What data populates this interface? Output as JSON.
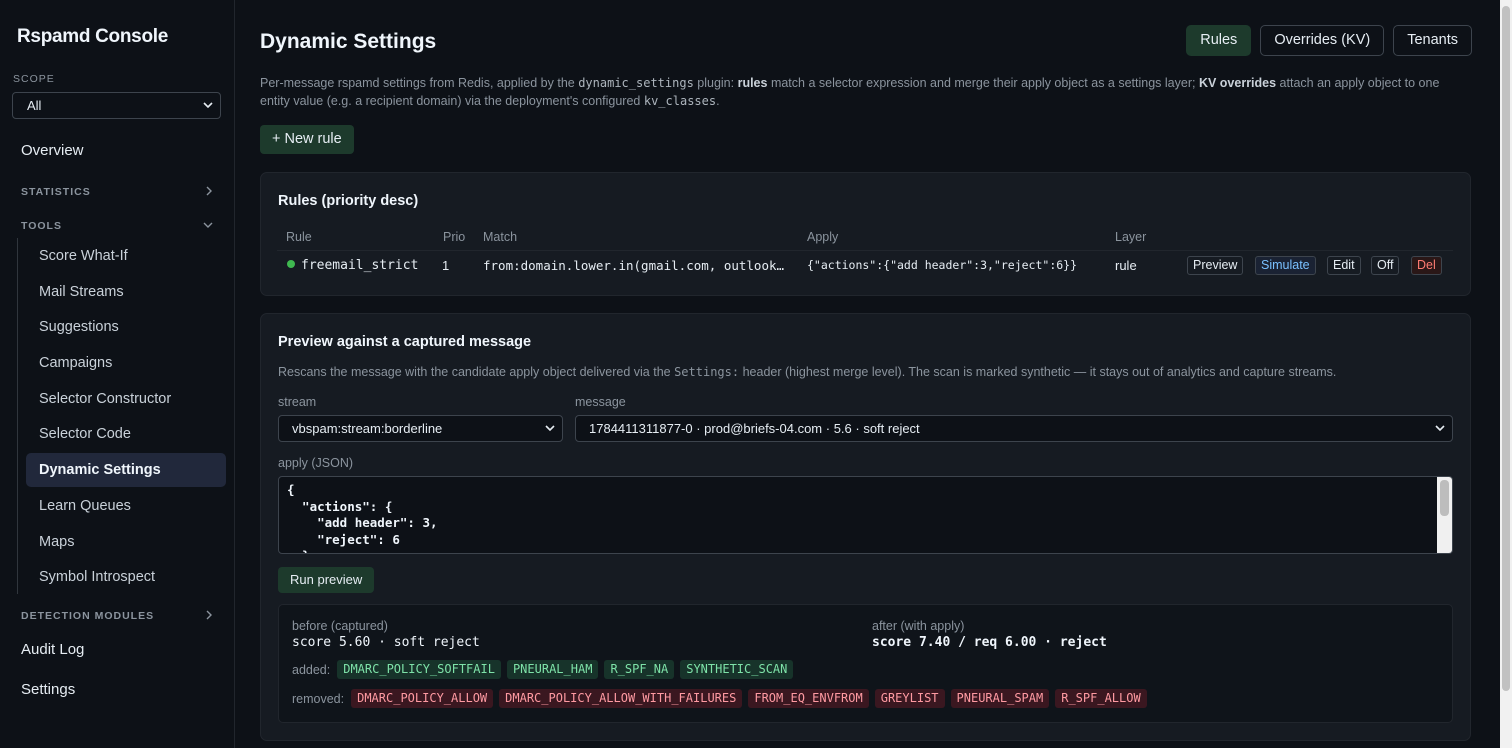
{
  "sidebar": {
    "brand": "Rspamd Console",
    "scope_label": "SCOPE",
    "scope_value": "All",
    "overview": "Overview",
    "statistics": "STATISTICS",
    "tools": "TOOLS",
    "tool_items": [
      "Score What-If",
      "Mail Streams",
      "Suggestions",
      "Campaigns",
      "Selector Constructor",
      "Selector Code",
      "Dynamic Settings",
      "Learn Queues",
      "Maps",
      "Symbol Introspect"
    ],
    "active_item": "Dynamic Settings",
    "detection_modules": "DETECTION MODULES",
    "audit_log": "Audit Log",
    "settings": "Settings"
  },
  "header": {
    "title": "Dynamic Settings",
    "tabs": [
      "Rules",
      "Overrides (KV)",
      "Tenants"
    ],
    "active_tab": "Rules",
    "description": {
      "p1": "Per-message rspamd settings from Redis, applied by the ",
      "code1": "dynamic_settings",
      "p2": " plugin: ",
      "b1": "rules",
      "p3": " match a selector expression and merge their apply object as a settings layer; ",
      "b2": "KV overrides",
      "p4": " attach an apply object to one entity value (e.g. a recipient domain) via the deployment's configured ",
      "code2": "kv_classes",
      "p5": "."
    },
    "new_rule_label": "+ New rule"
  },
  "rules_card": {
    "title": "Rules (priority desc)",
    "columns": [
      "Rule",
      "Prio",
      "Match",
      "Apply",
      "Layer"
    ],
    "rows": [
      {
        "rule": "freemail_strict",
        "prio": "1",
        "match": "from:domain.lower.in(gmail.com, outlook…",
        "apply": "{\"actions\":{\"add header\":3,\"reject\":6}}",
        "layer": "rule",
        "status_color": "#3fb950",
        "actions": [
          "Preview",
          "Simulate",
          "Edit",
          "Off",
          "Del"
        ]
      }
    ]
  },
  "preview_card": {
    "title": "Preview against a captured message",
    "description": {
      "p1": "Rescans the message with the candidate apply object delivered via the ",
      "code": "Settings:",
      "p2": " header (highest merge level). The scan is marked synthetic — it stays out of analytics and capture streams."
    },
    "stream_label": "stream",
    "stream_value": "vbspam:stream:borderline",
    "message_label": "message",
    "message_value": "1784411311877-0 · prod@briefs-04.com · 5.6 · soft reject",
    "apply_label": "apply (JSON)",
    "apply_json": "{\n  \"actions\": {\n    \"add header\": 3,\n    \"reject\": 6\n  }\n}",
    "run_label": "Run preview",
    "result": {
      "before_label": "before (captured)",
      "before_value": "score 5.60 · soft reject",
      "after_label": "after (with apply)",
      "after_value": "score 7.40 / req 6.00 · reject",
      "added_label": "added:",
      "added": [
        "DMARC_POLICY_SOFTFAIL",
        "PNEURAL_HAM",
        "R_SPF_NA",
        "SYNTHETIC_SCAN"
      ],
      "removed_label": "removed:",
      "removed": [
        "DMARC_POLICY_ALLOW",
        "DMARC_POLICY_ALLOW_WITH_FAILURES",
        "FROM_EQ_ENVFROM",
        "GREYLIST",
        "PNEURAL_SPAM",
        "R_SPF_ALLOW"
      ]
    }
  },
  "colors": {
    "accent_green": "#1d3a2c",
    "status_green": "#3fb950",
    "simulate_blue": "#79c0ff",
    "delete_red": "#ff7b72"
  }
}
